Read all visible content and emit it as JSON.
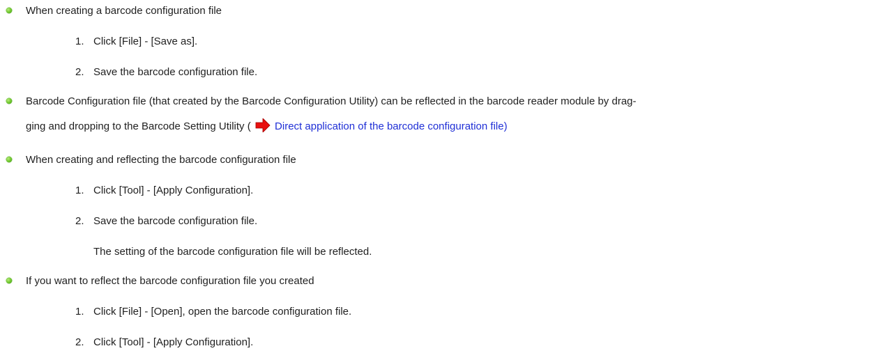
{
  "items": [
    {
      "text": "When creating a barcode configuration file",
      "steps": [
        {
          "num": "1.",
          "text": "Click [File] - [Save as]."
        },
        {
          "num": "2.",
          "text": "Save the barcode configuration file."
        }
      ]
    },
    {
      "line1": "Barcode Configuration file (that created by the Barcode Configuration Utility) can be reflected in the barcode reader module by drag-",
      "line2_prefix": "ging and dropping to the Barcode Setting Utility (",
      "link_text": "Direct application of the barcode configuration file)",
      "icon": "red-arrow-right-icon"
    },
    {
      "text": "When creating and reflecting the barcode configuration file",
      "steps": [
        {
          "num": "1.",
          "text": "Click [Tool] - [Apply Configuration]."
        },
        {
          "num": "2.",
          "text": "Save the barcode configuration file."
        }
      ],
      "note": "The setting of the barcode configuration file will be reflected."
    },
    {
      "text": "If you want to reflect the barcode configuration file you created",
      "steps": [
        {
          "num": "1.",
          "text": "Click [File] - [Open], open the barcode configuration file."
        },
        {
          "num": "2.",
          "text": "Click [Tool] - [Apply Configuration]."
        }
      ]
    }
  ],
  "colors": {
    "text": "#1f1f1f",
    "link": "#1f2fd6",
    "bullet": "#6cc52a",
    "arrow": "#e8100f"
  }
}
